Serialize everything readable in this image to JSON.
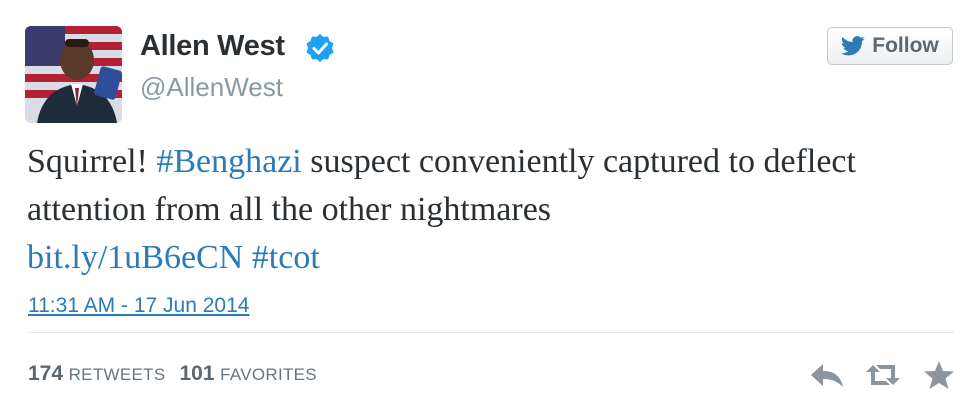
{
  "author": {
    "name": "Allen West",
    "handle": "@AllenWest",
    "verified_icon": "verified-badge-icon",
    "avatar_alt": "profile-photo"
  },
  "follow_button": {
    "label": "Follow",
    "icon": "twitter-bird-icon"
  },
  "tweet": {
    "text_part1": "Squirrel! ",
    "hashtag1": "#Benghazi",
    "text_part2": " suspect conveniently captured to deflect attention from all the other nightmares ",
    "link": "bit.ly/1uB6eCN",
    "space": " ",
    "hashtag2": "#tcot"
  },
  "timestamp": "11:31 AM - 17 Jun 2014",
  "stats": {
    "retweets_count": "174",
    "retweets_label": "RETWEETS",
    "favorites_count": "101",
    "favorites_label": "FAVORITES"
  },
  "actions": [
    "reply-icon",
    "retweet-icon",
    "favorite-icon"
  ],
  "colors": {
    "link": "#2b7bb9",
    "verified": "#1da1f2",
    "muted": "#8899a6"
  }
}
